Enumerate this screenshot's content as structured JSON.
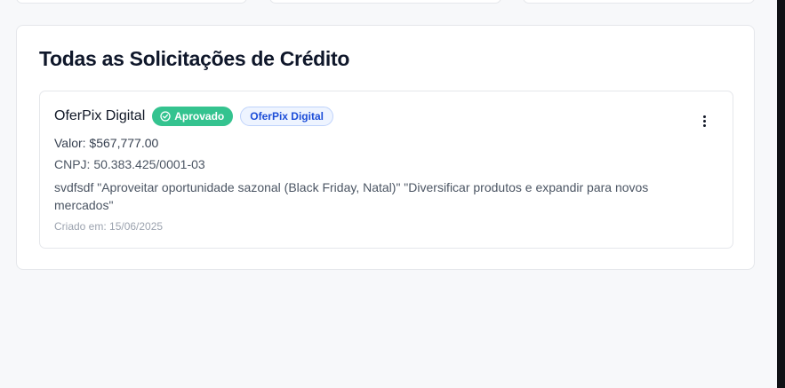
{
  "section": {
    "title": "Todas as Solicitações de Crédito"
  },
  "request": {
    "name": "OferPix Digital",
    "status": "Aprovado",
    "source": "OferPix Digital",
    "value": "Valor: $567,777.00",
    "cnpj": "CNPJ: 50.383.425/0001-03",
    "description": "svdfsdf \"Aproveitar oportunidade sazonal (Black Friday, Natal)\" \"Diversificar produtos e expandir para novos mercados\"",
    "created": "Criado em: 15/06/2025"
  },
  "colors": {
    "status_approved": "#34c38f",
    "source_badge_text": "#1d4ed8",
    "source_badge_bg": "#eef4ff"
  },
  "icons": {
    "status": "check-circle-icon",
    "menu": "more-vertical-icon"
  }
}
